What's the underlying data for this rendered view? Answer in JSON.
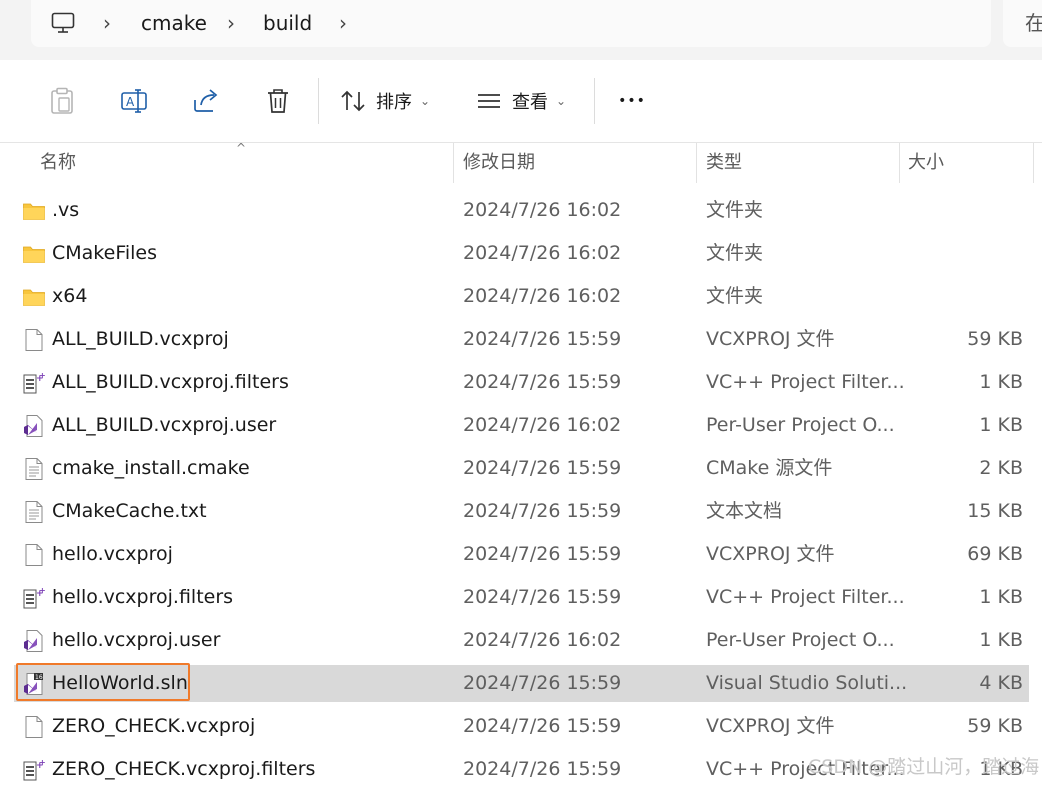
{
  "breadcrumb": {
    "items": [
      "cmake",
      "build"
    ],
    "separator": "›",
    "search_partial": "在"
  },
  "toolbar": {
    "sort_label": "排序",
    "view_label": "查看",
    "more_label": "•••"
  },
  "columns": {
    "name": "名称",
    "modified": "修改日期",
    "type": "类型",
    "size": "大小"
  },
  "files": [
    {
      "name": ".vs",
      "modified": "2024/7/26 16:02",
      "type": "文件夹",
      "size": "",
      "icon": "folder-icon"
    },
    {
      "name": "CMakeFiles",
      "modified": "2024/7/26 16:02",
      "type": "文件夹",
      "size": "",
      "icon": "folder-icon"
    },
    {
      "name": "x64",
      "modified": "2024/7/26 16:02",
      "type": "文件夹",
      "size": "",
      "icon": "folder-icon"
    },
    {
      "name": "ALL_BUILD.vcxproj",
      "modified": "2024/7/26 15:59",
      "type": "VCXPROJ 文件",
      "size": "59 KB",
      "icon": "blank-file-icon"
    },
    {
      "name": "ALL_BUILD.vcxproj.filters",
      "modified": "2024/7/26 15:59",
      "type": "VC++ Project Filter...",
      "size": "1 KB",
      "icon": "filters-file-icon"
    },
    {
      "name": "ALL_BUILD.vcxproj.user",
      "modified": "2024/7/26 16:02",
      "type": "Per-User Project O...",
      "size": "1 KB",
      "icon": "vs-user-file-icon"
    },
    {
      "name": "cmake_install.cmake",
      "modified": "2024/7/26 15:59",
      "type": "CMake 源文件",
      "size": "2 KB",
      "icon": "text-file-icon"
    },
    {
      "name": "CMakeCache.txt",
      "modified": "2024/7/26 15:59",
      "type": "文本文档",
      "size": "15 KB",
      "icon": "text-file-icon"
    },
    {
      "name": "hello.vcxproj",
      "modified": "2024/7/26 15:59",
      "type": "VCXPROJ 文件",
      "size": "69 KB",
      "icon": "blank-file-icon"
    },
    {
      "name": "hello.vcxproj.filters",
      "modified": "2024/7/26 15:59",
      "type": "VC++ Project Filter...",
      "size": "1 KB",
      "icon": "filters-file-icon"
    },
    {
      "name": "hello.vcxproj.user",
      "modified": "2024/7/26 16:02",
      "type": "Per-User Project O...",
      "size": "1 KB",
      "icon": "vs-user-file-icon"
    },
    {
      "name": "HelloWorld.sln",
      "modified": "2024/7/26 15:59",
      "type": "Visual Studio Soluti...",
      "size": "4 KB",
      "icon": "vs-solution-icon",
      "selected": true
    },
    {
      "name": "ZERO_CHECK.vcxproj",
      "modified": "2024/7/26 15:59",
      "type": "VCXPROJ 文件",
      "size": "59 KB",
      "icon": "blank-file-icon"
    },
    {
      "name": "ZERO_CHECK.vcxproj.filters",
      "modified": "2024/7/26 15:59",
      "type": "VC++ Project Filter...",
      "size": "1 KB",
      "icon": "filters-file-icon"
    }
  ],
  "watermark": "CSDN @踏过山河，踏过海",
  "colors": {
    "selection": "#d9d9d9",
    "focus_border": "#f07a2a",
    "folder": "#f8c63d",
    "vs_purple": "#7b3fb5"
  }
}
